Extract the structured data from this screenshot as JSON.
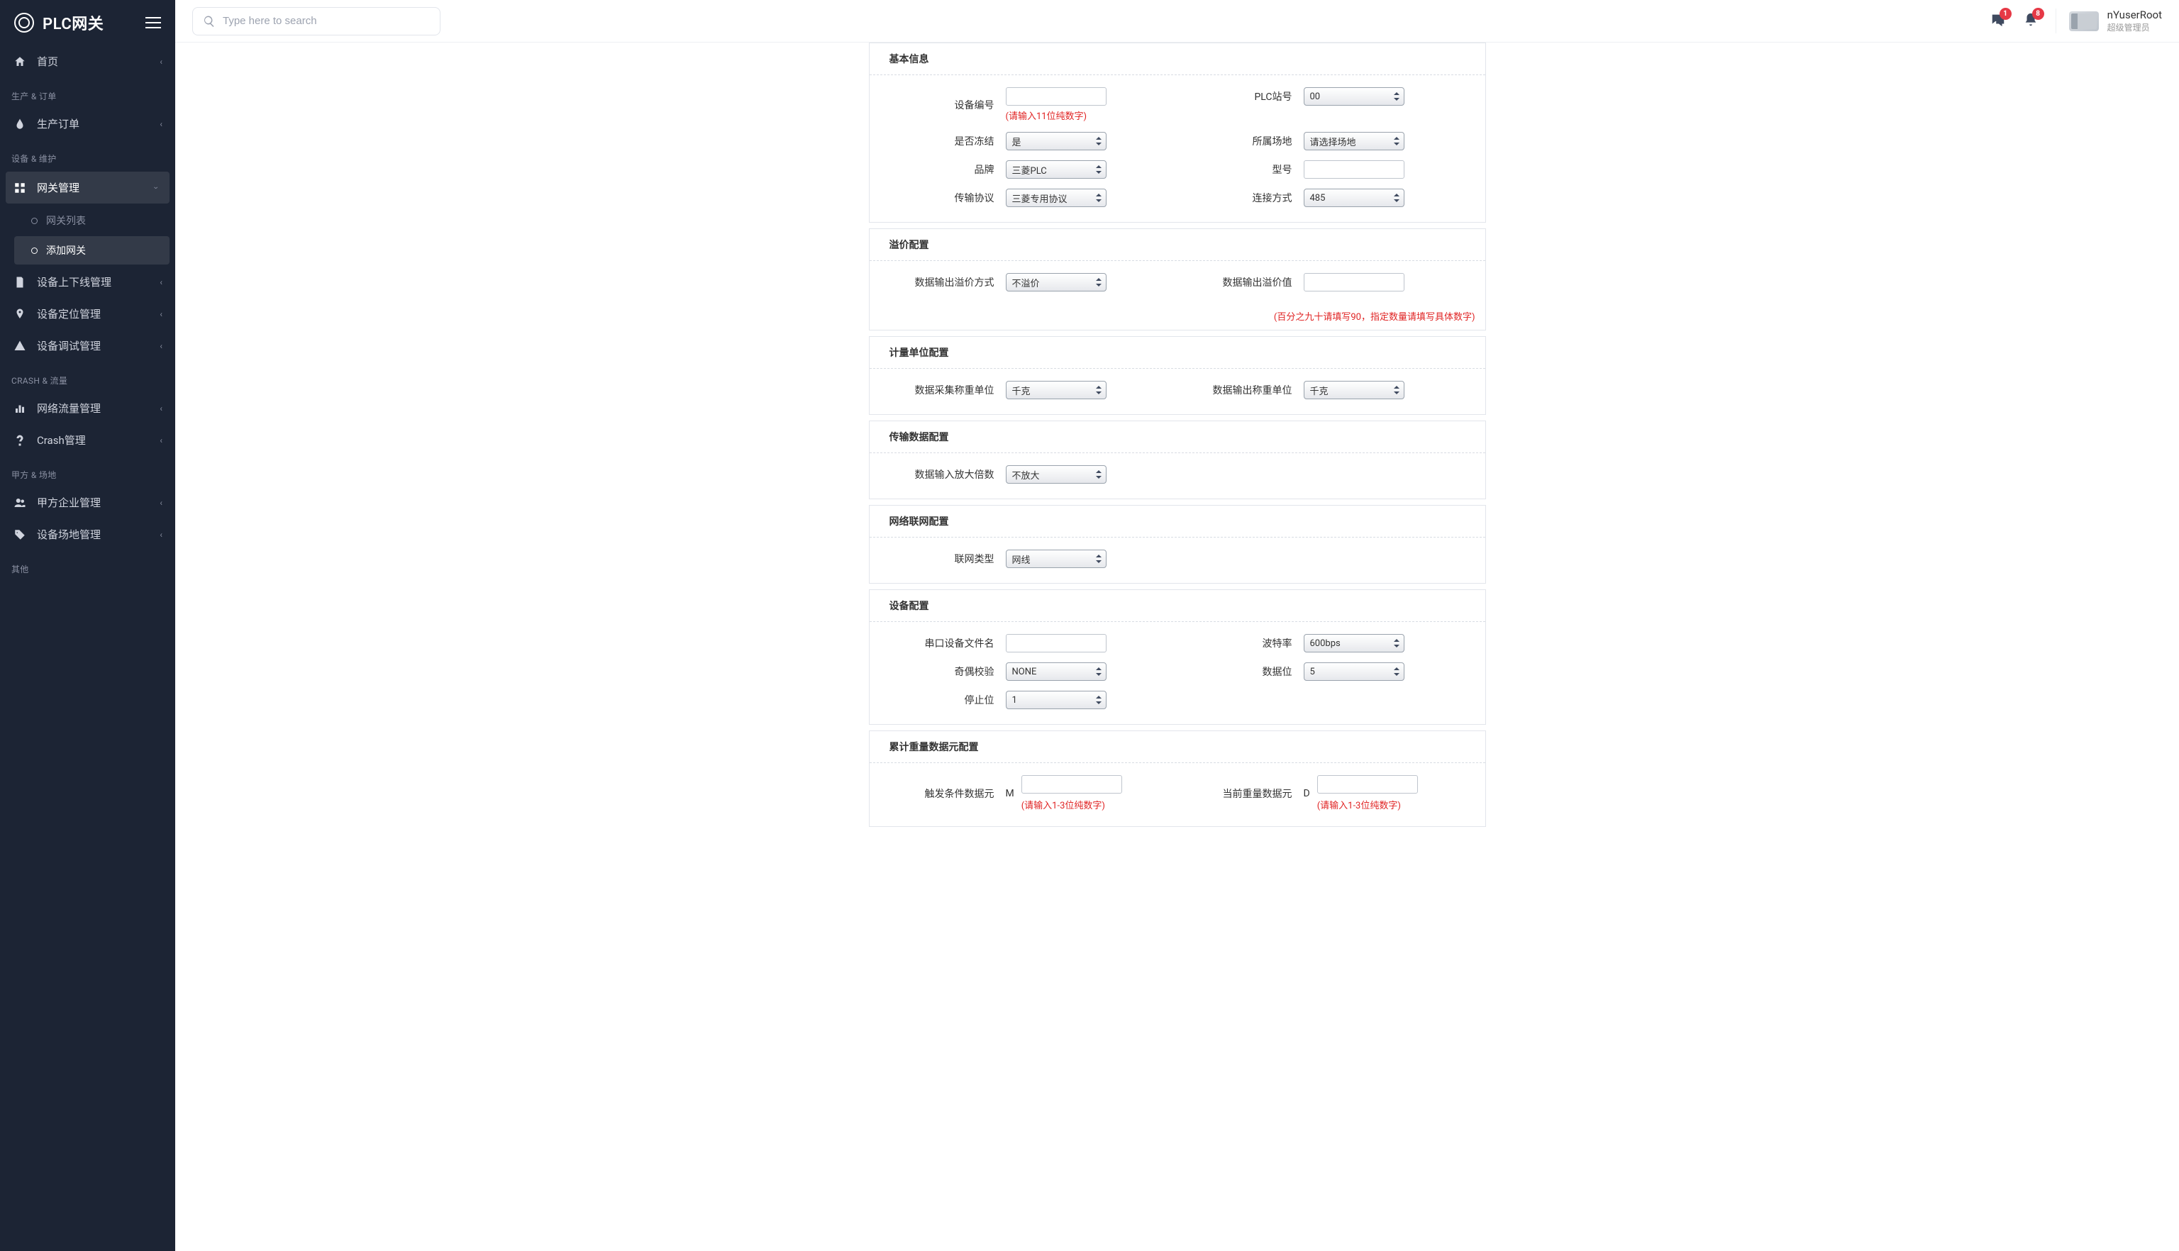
{
  "brand": {
    "title": "PLC网关"
  },
  "search": {
    "placeholder": "Type here to search"
  },
  "notifications": {
    "chat_count": "1",
    "bell_count": "8"
  },
  "user": {
    "name": "nYuserRoot",
    "role": "超级管理员"
  },
  "sidebar": {
    "home": {
      "label": "首页"
    },
    "section_prod": {
      "label": "生产 & 订单"
    },
    "prod_order": {
      "label": "生产订单"
    },
    "section_device": {
      "label": "设备 & 维护"
    },
    "gateway_mgmt": {
      "label": "网关管理"
    },
    "gateway_list": {
      "label": "网关列表"
    },
    "gateway_add": {
      "label": "添加网关"
    },
    "device_online": {
      "label": "设备上下线管理"
    },
    "device_locate": {
      "label": "设备定位管理"
    },
    "device_debug": {
      "label": "设备调试管理"
    },
    "section_crash": {
      "label": "CRASH & 流量"
    },
    "traffic": {
      "label": "网络流量管理"
    },
    "crash": {
      "label": "Crash管理"
    },
    "section_party": {
      "label": "甲方 & 场地"
    },
    "party_ent": {
      "label": "甲方企业管理"
    },
    "party_site": {
      "label": "设备场地管理"
    },
    "section_other": {
      "label": "其他"
    }
  },
  "form": {
    "basic": {
      "title": "基本信息",
      "device_no": {
        "label": "设备编号",
        "value": "",
        "hint": "(请输入11位纯数字)"
      },
      "plc_station": {
        "label": "PLC站号",
        "value": "00"
      },
      "frozen": {
        "label": "是否冻结",
        "value": "是"
      },
      "site": {
        "label": "所属场地",
        "value": "请选择场地"
      },
      "brand": {
        "label": "品牌",
        "value": "三菱PLC"
      },
      "model": {
        "label": "型号",
        "value": ""
      },
      "protocol": {
        "label": "传输协议",
        "value": "三菱专用协议"
      },
      "connect": {
        "label": "连接方式",
        "value": "485"
      }
    },
    "premium": {
      "title": "溢价配置",
      "out_mode": {
        "label": "数据输出溢价方式",
        "value": "不溢价"
      },
      "out_value": {
        "label": "数据输出溢价值",
        "value": "",
        "hint": "(百分之九十请填写90，指定数量请填写具体数字)"
      }
    },
    "unit": {
      "title": "计量单位配置",
      "collect_unit": {
        "label": "数据采集称重单位",
        "value": "千克"
      },
      "output_unit": {
        "label": "数据输出称重单位",
        "value": "千克"
      }
    },
    "transfer": {
      "title": "传输数据配置",
      "amplify": {
        "label": "数据输入放大倍数",
        "value": "不放大"
      }
    },
    "network": {
      "title": "网络联网配置",
      "net_type": {
        "label": "联网类型",
        "value": "网线"
      }
    },
    "device": {
      "title": "设备配置",
      "serial_file": {
        "label": "串口设备文件名",
        "value": ""
      },
      "baud": {
        "label": "波特率",
        "value": "600bps"
      },
      "parity": {
        "label": "奇偶校验",
        "value": "NONE"
      },
      "data_bits": {
        "label": "数据位",
        "value": "5"
      },
      "stop_bits": {
        "label": "停止位",
        "value": "1"
      }
    },
    "accum": {
      "title": "累计重量数据元配置",
      "trigger": {
        "label": "触发条件数据元",
        "prefix": "M",
        "value": "",
        "hint": "(请输入1-3位纯数字)"
      },
      "current": {
        "label": "当前重量数据元",
        "prefix": "D",
        "value": "",
        "hint": "(请输入1-3位纯数字)"
      }
    }
  }
}
